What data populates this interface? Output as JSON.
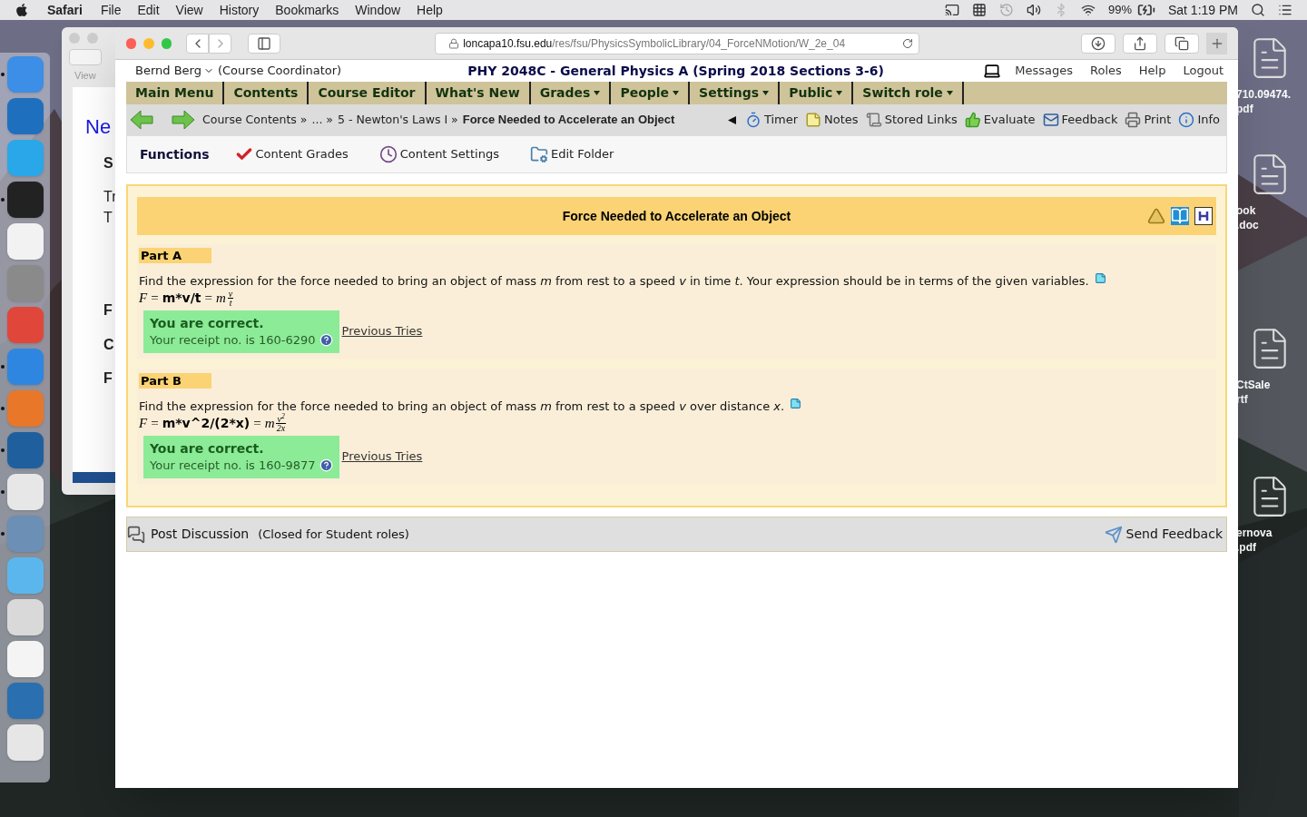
{
  "menubar": {
    "app": "Safari",
    "menus": [
      "File",
      "Edit",
      "View",
      "History",
      "Bookmarks",
      "Window",
      "Help"
    ],
    "battery": "99%",
    "clock": "Sat 1:19 PM"
  },
  "dock": {
    "apps": [
      {
        "color": "#3d8ee6",
        "running": true
      },
      {
        "color": "#1f6fbf",
        "running": false
      },
      {
        "color": "#2aa7e8",
        "running": false
      },
      {
        "color": "#222222",
        "running": true
      },
      {
        "color": "#f2f2f2",
        "running": false
      },
      {
        "color": "#8a8a8a",
        "running": false
      },
      {
        "color": "#e0463a",
        "running": false
      },
      {
        "color": "#2f86e0",
        "running": true
      },
      {
        "color": "#e8772a",
        "running": true
      },
      {
        "color": "#1f5f9e",
        "running": true
      },
      {
        "color": "#e7e7e7",
        "running": true
      },
      {
        "color": "#6b8fb5",
        "running": true
      },
      {
        "color": "#5cb6ee",
        "running": false
      },
      {
        "color": "#d9d9d9",
        "running": false
      },
      {
        "color": "#f4f4f4",
        "running": false
      },
      {
        "color": "#2a6fb0",
        "running": false
      },
      {
        "color": "#e6e6e6",
        "running": false
      }
    ]
  },
  "desktop_icons": [
    {
      "lines": [
        "710.09474.",
        "pdf"
      ]
    },
    {
      "lines": [
        "ook",
        ".doc"
      ]
    },
    {
      "lines": [
        "CtSale",
        "rtf"
      ]
    },
    {
      "lines": [
        "ernova",
        ".pdf"
      ]
    }
  ],
  "background_window": {
    "toolbar_label": "View",
    "heading": "Ne",
    "fragments": [
      "S",
      "Tr",
      "T",
      "F",
      "C",
      "F"
    ]
  },
  "browser": {
    "url_host": "loncapa10.fsu.edu",
    "url_path": "/res/fsu/PhysicsSymbolicLibrary/04_ForceNMotion/W_2e_04"
  },
  "page": {
    "user": "Bernd Berg",
    "role": "(Course Coordinator)",
    "course": "PHY 2048C - General Physics A (Spring 2018 Sections 3-6)",
    "top_links": [
      "Messages",
      "Roles",
      "Help",
      "Logout"
    ],
    "nav": [
      {
        "label": "Main Menu",
        "dropdown": false
      },
      {
        "label": "Contents",
        "dropdown": false
      },
      {
        "label": "Course Editor",
        "dropdown": false
      },
      {
        "label": "What's New",
        "dropdown": false
      },
      {
        "label": "Grades",
        "dropdown": true
      },
      {
        "label": "People",
        "dropdown": true
      },
      {
        "label": "Settings",
        "dropdown": true
      },
      {
        "label": "Public",
        "dropdown": true
      },
      {
        "label": "Switch role",
        "dropdown": true
      }
    ],
    "breadcrumb": [
      "Course Contents »",
      "... »",
      "5 - Newton's Laws I »"
    ],
    "current": "Force Needed to Accelerate an Object",
    "tools": [
      {
        "kind": "timer",
        "label": "Timer"
      },
      {
        "kind": "notes",
        "label": "Notes"
      },
      {
        "kind": "links",
        "label": "Stored Links"
      },
      {
        "kind": "evaluate",
        "label": "Evaluate"
      },
      {
        "kind": "feedback",
        "label": "Feedback"
      },
      {
        "kind": "print",
        "label": "Print"
      },
      {
        "kind": "info",
        "label": "Info"
      }
    ],
    "functions": {
      "title": "Functions",
      "items": [
        {
          "kind": "grades",
          "label": "Content Grades"
        },
        {
          "kind": "settings",
          "label": "Content Settings"
        },
        {
          "kind": "folder",
          "label": "Edit Folder"
        }
      ]
    },
    "problem": {
      "title": "Force Needed to Accelerate an Object",
      "parts": [
        {
          "label": "Part A",
          "text": "Find the expression for the force needed to bring an object of mass *m* from rest to a speed *v* in time *t*. Your expression should be in terms of the given variables.",
          "variable": "F",
          "relations": [
            "=",
            "="
          ],
          "entered": "m*v/t",
          "factor": "m",
          "numerator": "v",
          "denominator": "t",
          "status": "You are correct.",
          "receipt": "Your receipt no. is 160-6290",
          "link": "Previous Tries"
        },
        {
          "label": "Part B",
          "text": "Find the expression for the force needed to bring an object of mass *m* from rest to a speed *v* over distance *x*.",
          "variable": "F",
          "relations": [
            "=",
            "="
          ],
          "entered": "m*v^2/(2*x)",
          "factor": "m",
          "numerator": "v$^{2}$",
          "denominator": "2x",
          "status": "You are correct.",
          "receipt": "Your receipt no. is 160-9877",
          "link": "Previous Tries"
        }
      ]
    },
    "discussion": {
      "label": "Post Discussion",
      "note": "(Closed for Student roles)",
      "feedback": "Send Feedback"
    }
  }
}
